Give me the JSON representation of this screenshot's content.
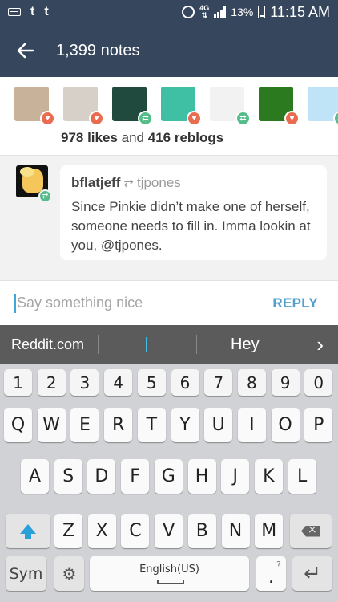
{
  "status_bar": {
    "left_icons": [
      "keyboard-icon",
      "tumblr-icon",
      "tumblr-icon"
    ],
    "alarm_icon": "alarm-icon",
    "network": "4G",
    "battery": "13%",
    "time": "11:15 AM"
  },
  "header": {
    "title": "1,399 notes",
    "back_icon": "arrow-left-icon"
  },
  "avatars": [
    {
      "color": "#c9b29a",
      "badge": "like"
    },
    {
      "color": "#d6d0c8",
      "badge": "like"
    },
    {
      "color": "#1f4a3d",
      "badge": "reblog"
    },
    {
      "color": "#3fbfa4",
      "badge": "like"
    },
    {
      "color": "#f2f2f2",
      "badge": "reblog"
    },
    {
      "color": "#2c7a1f",
      "badge": "like"
    },
    {
      "color": "#bfe3f7",
      "badge": "reblog"
    }
  ],
  "summary": {
    "likes": "978 likes",
    "and": "and",
    "reblogs": "416 reblogs"
  },
  "note": {
    "username": "bflatjeff",
    "source": "tjpones",
    "text": "Since Pinkie didn’t make one of herself, someone needs to fill in. Imma lookin at you, @tjpones."
  },
  "reply": {
    "placeholder": "Say something nice",
    "button": "REPLY"
  },
  "suggestions": {
    "left": "Reddit.com",
    "middle": "|",
    "right": "Hey",
    "arrow": "›"
  },
  "keyboard": {
    "numbers": [
      "1",
      "2",
      "3",
      "4",
      "5",
      "6",
      "7",
      "8",
      "9",
      "0"
    ],
    "row1": [
      "Q",
      "W",
      "E",
      "R",
      "T",
      "Y",
      "U",
      "I",
      "O",
      "P"
    ],
    "row2": [
      "A",
      "S",
      "D",
      "F",
      "G",
      "H",
      "J",
      "K",
      "L"
    ],
    "row3": [
      "Z",
      "X",
      "C",
      "V",
      "B",
      "N",
      "M"
    ],
    "sym": "Sym",
    "space": "English(US)",
    "punct_small": "?",
    "punct_big": "."
  },
  "colors": {
    "header_bg": "#36465d",
    "like": "#e96b50",
    "reblog": "#56bc8a",
    "reply_accent": "#529ecc"
  }
}
